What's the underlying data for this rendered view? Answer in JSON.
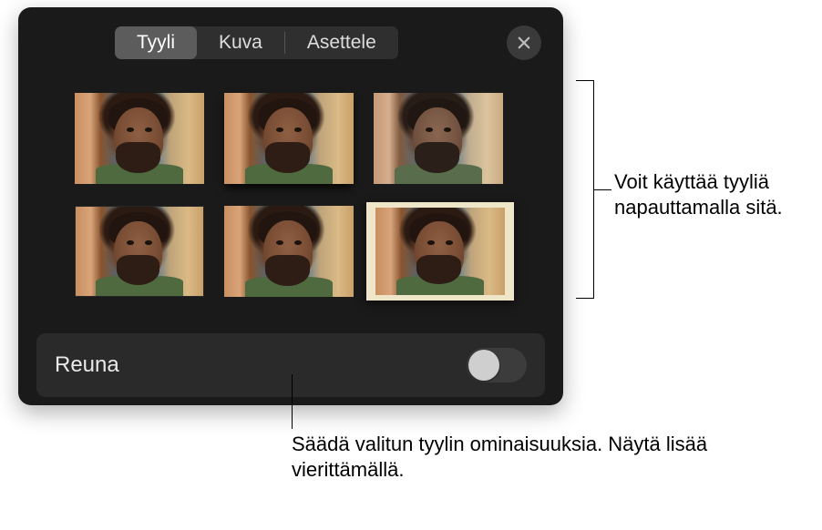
{
  "tabs": {
    "style": "Tyyli",
    "image": "Kuva",
    "arrange": "Asettele"
  },
  "styles": {
    "count": 6,
    "selected_index": 5
  },
  "border": {
    "label": "Reuna",
    "enabled": false
  },
  "callouts": {
    "styles_hint": "Voit käyttää tyyliä napauttamalla sitä.",
    "properties_hint": "Säädä valitun tyylin ominaisuuksia. Näytä lisää vierittämällä."
  },
  "icons": {
    "close": "close-icon"
  }
}
